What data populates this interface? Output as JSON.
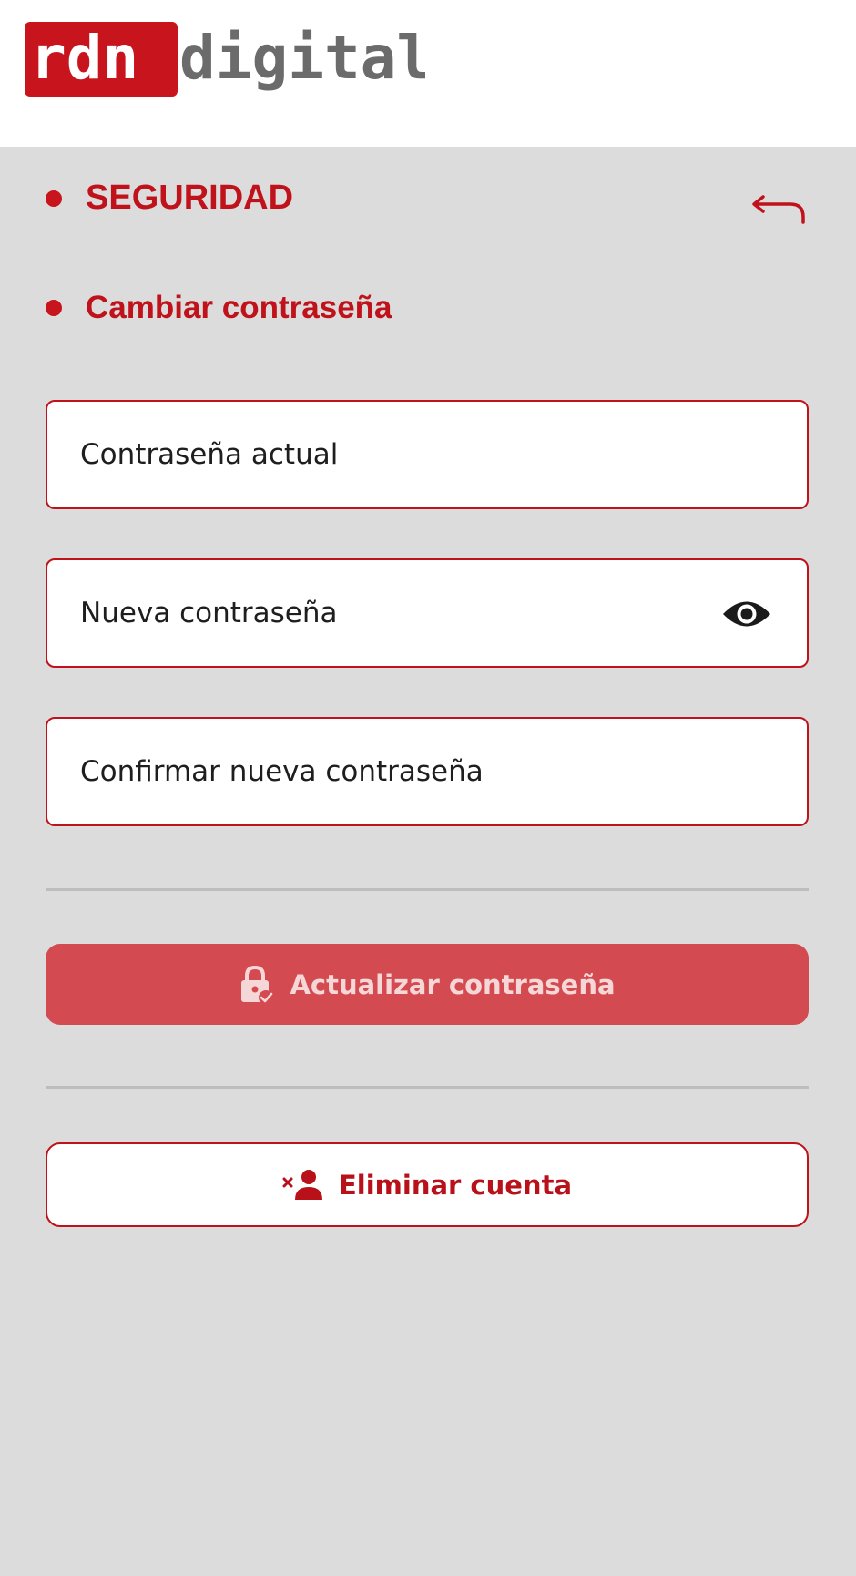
{
  "brand": {
    "logo_text_red": "rdn",
    "logo_text_grey": "digital",
    "colors": {
      "red": "#c8141c",
      "grey": "#6b6b6b"
    }
  },
  "sections": {
    "security_title": "SEGURIDAD",
    "change_password_title": "Cambiar contraseña"
  },
  "icons": {
    "back": "back-arrow-icon",
    "eye": "eye-icon",
    "lock": "lock-check-icon",
    "remove_user": "remove-user-icon"
  },
  "form": {
    "current_password": {
      "placeholder": "Contraseña actual",
      "value": ""
    },
    "new_password": {
      "placeholder": "Nueva contraseña",
      "value": ""
    },
    "confirm_password": {
      "placeholder": "Confirmar nueva contraseña",
      "value": ""
    }
  },
  "buttons": {
    "update_password": "Actualizar contraseña",
    "delete_account": "Eliminar cuenta"
  },
  "theme": {
    "background": "#dcdcdd",
    "accent": "#c0121a",
    "button_disabled": "#d34b50"
  }
}
